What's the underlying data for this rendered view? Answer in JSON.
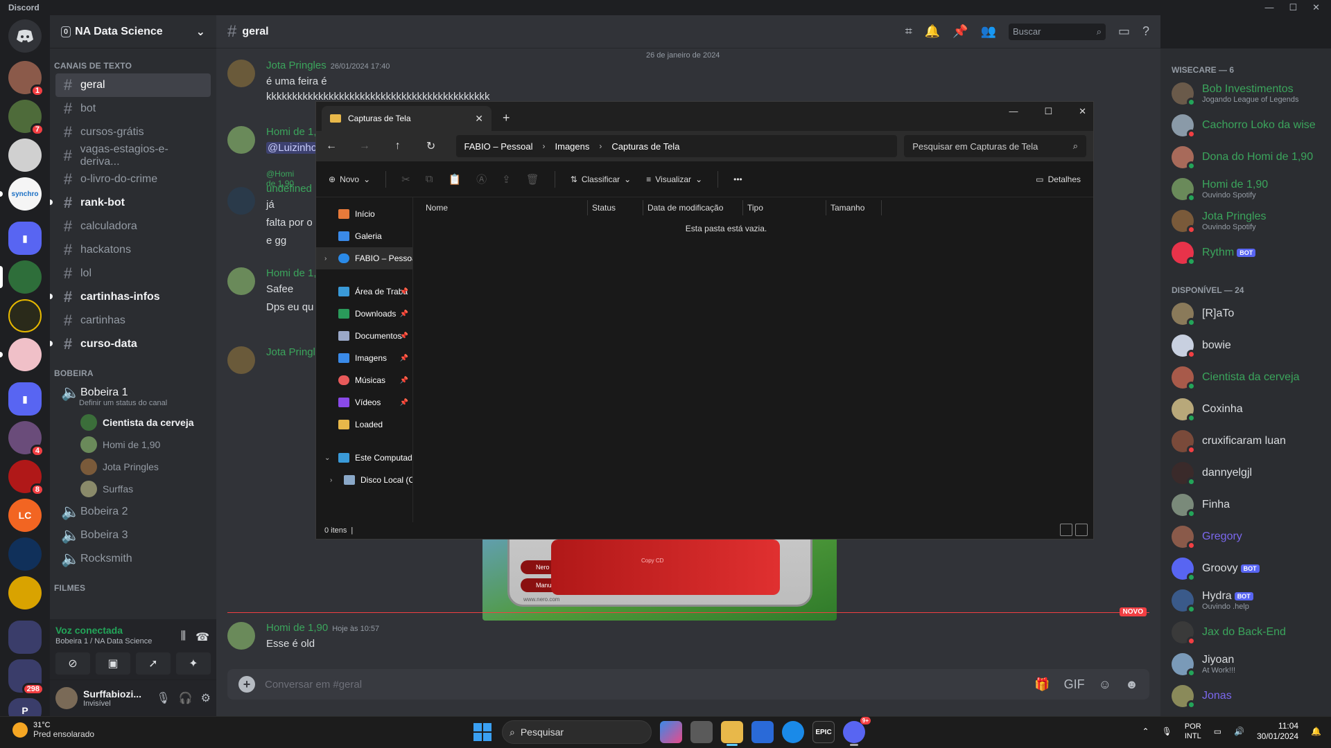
{
  "app": {
    "title": "Discord"
  },
  "servers": {
    "badges": [
      "1",
      "7",
      "4",
      "8",
      "298"
    ]
  },
  "sidebar": {
    "guild_name": "NA Data Science",
    "guild_badge": "0",
    "categories": {
      "text": "CANAIS DE TEXTO",
      "bobeira": "BOBEIRA",
      "filmes": "FILMES"
    },
    "channels": [
      "geral",
      "bot",
      "cursos-grátis",
      "vagas-estagios-e-deriva...",
      "o-livro-do-crime",
      "rank-bot",
      "calculadora",
      "hackatons",
      "lol",
      "cartinhas-infos",
      "cartinhas",
      "curso-data"
    ],
    "voice": {
      "channel": "Bobeira 1",
      "status_prompt": "Definir um status do canal",
      "users": [
        "Cientista da cerveja",
        "Homi de 1,90",
        "Jota Pringles",
        "Surffas"
      ],
      "others": [
        "Bobeira 2",
        "Bobeira 3",
        "Rocksmith"
      ]
    },
    "voice_bar": {
      "status": "Voz conectada",
      "location": "Bobeira 1 / NA Data Science"
    },
    "user": {
      "name": "Surffabiozi...",
      "status": "Invisível"
    }
  },
  "chat": {
    "channel": "geral",
    "search_placeholder": "Buscar",
    "date_divider": "26 de janeiro de 2024",
    "messages": [
      {
        "author": "Jota Pringles",
        "time": "26/01/2024 17:40",
        "lines": [
          "é uma feira é",
          "kkkkkkkkkkkkkkkkkkkkkkkkkkkkkkkkkkkkkkkkkkk"
        ]
      },
      {
        "author": "Homi de 1,90",
        "mention": "@Luizinho",
        "lines": []
      },
      {
        "reply": "@Homi de 1,90",
        "author": "undefined",
        "lines": [
          "já",
          "falta por o",
          "e gg"
        ]
      },
      {
        "author": "Homi de 1,90",
        "lines": [
          "Safee",
          "Dps eu qu"
        ]
      },
      {
        "author": "Jota Pringles",
        "lines": []
      },
      {
        "author": "Homi de 1,90",
        "time": "Hoje às 10:57",
        "lines": [
          "Esse é old"
        ]
      }
    ],
    "new_tag": "NOVO",
    "composer_placeholder": "Conversar em #geral",
    "embed_labels": {
      "toolkit": "Nero Toolkit",
      "manuals": "Manuals",
      "copy": "Copy CD",
      "site": "www.nero.com"
    }
  },
  "members": {
    "group1_title": "WISECARE — 6",
    "group1": [
      {
        "name": "Bob Investimentos",
        "sub": "Jogando League of Legends",
        "color": "#3ba55c"
      },
      {
        "name": "Cachorro Loko da wise",
        "sub": "",
        "color": "#3ba55c"
      },
      {
        "name": "Dona do Homi de 1,90",
        "sub": "",
        "color": "#3ba55c"
      },
      {
        "name": "Homi de 1,90",
        "sub": "Ouvindo Spotify",
        "color": "#3ba55c"
      },
      {
        "name": "Jota Pringles",
        "sub": "Ouvindo Spotify",
        "color": "#3ba55c"
      },
      {
        "name": "Rythm",
        "sub": "",
        "color": "#3ba55c",
        "bot": "BOT"
      }
    ],
    "group2_title": "DISPONÍVEL — 24",
    "group2": [
      {
        "name": "[R]aTo",
        "sub": "",
        "color": "#dbdee1"
      },
      {
        "name": "bowie",
        "sub": "",
        "color": "#dbdee1"
      },
      {
        "name": "Cientista da cerveja",
        "sub": "",
        "color": "#3ba55c"
      },
      {
        "name": "Coxinha",
        "sub": "",
        "color": "#dbdee1"
      },
      {
        "name": "cruxificaram luan",
        "sub": "",
        "color": "#dbdee1"
      },
      {
        "name": "dannyelgjl",
        "sub": "",
        "color": "#dbdee1"
      },
      {
        "name": "Finha",
        "sub": "",
        "color": "#dbdee1"
      },
      {
        "name": "Gregory",
        "sub": "",
        "color": "#7b68ee"
      },
      {
        "name": "Groovy",
        "sub": "",
        "color": "#dbdee1",
        "bot": "BOT"
      },
      {
        "name": "Hydra",
        "sub": "Ouvindo .help",
        "color": "#dbdee1",
        "bot": "BOT"
      },
      {
        "name": "Jax do Back-End",
        "sub": "",
        "color": "#3ba55c"
      },
      {
        "name": "Jiyoan",
        "sub": "At Work!!!",
        "color": "#dbdee1"
      },
      {
        "name": "Jonas",
        "sub": "",
        "color": "#7b68ee"
      }
    ]
  },
  "explorer": {
    "tab_title": "Capturas de Tela",
    "breadcrumbs": [
      "FABIO – Pessoal",
      "Imagens",
      "Capturas de Tela"
    ],
    "search_placeholder": "Pesquisar em Capturas de Tela",
    "commands": {
      "new": "Novo",
      "sort": "Classificar",
      "view": "Visualizar",
      "details": "Detalhes"
    },
    "nav": [
      "Início",
      "Galeria",
      "FABIO – Pessoal",
      "Área de Traba",
      "Downloads",
      "Documentos",
      "Imagens",
      "Músicas",
      "Vídeos",
      "Loaded",
      "Este Computador",
      "Disco Local (C:"
    ],
    "columns": [
      "Nome",
      "Status",
      "Data de modificação",
      "Tipo",
      "Tamanho"
    ],
    "empty_message": "Esta pasta está vazia.",
    "status": "0 itens"
  },
  "taskbar": {
    "temp": "31°C",
    "weather": "Pred ensolarado",
    "search": "Pesquisar",
    "lang_top": "POR",
    "lang_bottom": "INTL",
    "time": "11:04",
    "date": "30/01/2024",
    "discord_badge": "9+"
  }
}
